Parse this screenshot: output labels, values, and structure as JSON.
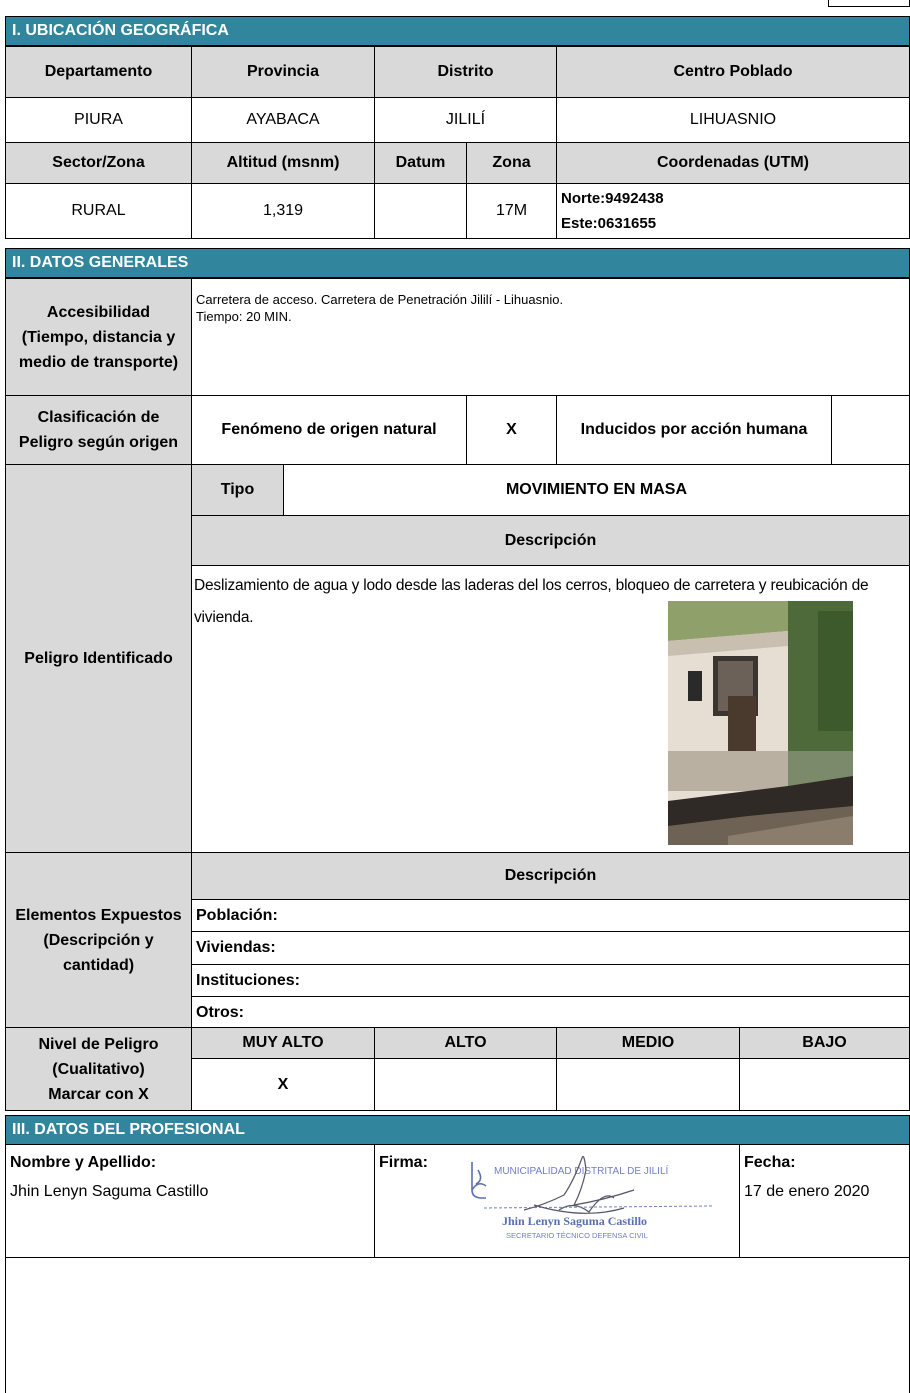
{
  "sections": {
    "s1": "I. UBICACIÓN GEOGRÁFICA",
    "s2": "II. DATOS GENERALES",
    "s3": "III. DATOS DEL PROFESIONAL"
  },
  "ubicacion": {
    "headers": [
      "Departamento",
      "Provincia",
      "Distrito",
      "Centro Poblado"
    ],
    "values": [
      "PIURA",
      "AYABACA",
      "JILILÍ",
      "LIHUASNIO"
    ],
    "headers2": [
      "Sector/Zona",
      "Altitud (msnm)",
      "Datum",
      "Zona",
      "Coordenadas (UTM)"
    ],
    "values2": {
      "sector": "RURAL",
      "altitud": "1,319",
      "datum": "",
      "zona": "17M",
      "norte": "Norte:9492438",
      "este": "Este:0631655"
    }
  },
  "generales": {
    "accesibilidad_label": [
      "Accesibilidad",
      "(Tiempo, distancia y",
      "medio de transporte)"
    ],
    "accesibilidad_text": [
      "Carretera de acceso. Carretera de Penetración Jililí - Lihuasnio.",
      "Tiempo: 20 MIN."
    ],
    "clasificacion_label": [
      "Clasificación de",
      "Peligro según origen"
    ],
    "fenomeno_natural": "Fenómeno de origen natural",
    "fenomeno_mark": "X",
    "inducidos": "Inducidos por acción humana",
    "inducidos_mark": "",
    "peligro_label": "Peligro Identificado",
    "tipo_label": "Tipo",
    "tipo_value": "MOVIMIENTO EN MASA",
    "descripcion_label": "Descripción",
    "descripcion_text": "Deslizamiento de agua y lodo desde las laderas del los cerros, bloqueo de carretera y reubicación de vivienda.",
    "expuestos_label": [
      "Elementos Expuestos",
      "(Descripción y",
      "cantidad)"
    ],
    "expuestos_desc_label": "Descripción",
    "expuestos_items": [
      "Población:",
      "Viviendas:",
      "Instituciones:",
      "Otros:"
    ],
    "nivel_label": [
      "Nivel de Peligro",
      "(Cualitativo)",
      "Marcar con X"
    ],
    "niveles": [
      "MUY ALTO",
      "ALTO",
      "MEDIO",
      "BAJO"
    ],
    "nivel_marks": [
      "X",
      "",
      "",
      ""
    ]
  },
  "profesional": {
    "nombre_label": "Nombre y Apellido:",
    "nombre_value": "Jhin Lenyn Saguma Castillo",
    "firma_label": "Firma:",
    "fecha_label": "Fecha:",
    "fecha_value": "17 de enero 2020",
    "stamp_line1": "MUNICIPALIDAD DISTRITAL DE JILILÍ",
    "stamp_line2": "Jhin Lenyn Saguma Castillo",
    "stamp_line3": "SECRETARIO TÉCNICO DEFENSA CIVIL"
  },
  "colors": {
    "section": "#31859c",
    "header_grey": "#d9d9d9"
  }
}
